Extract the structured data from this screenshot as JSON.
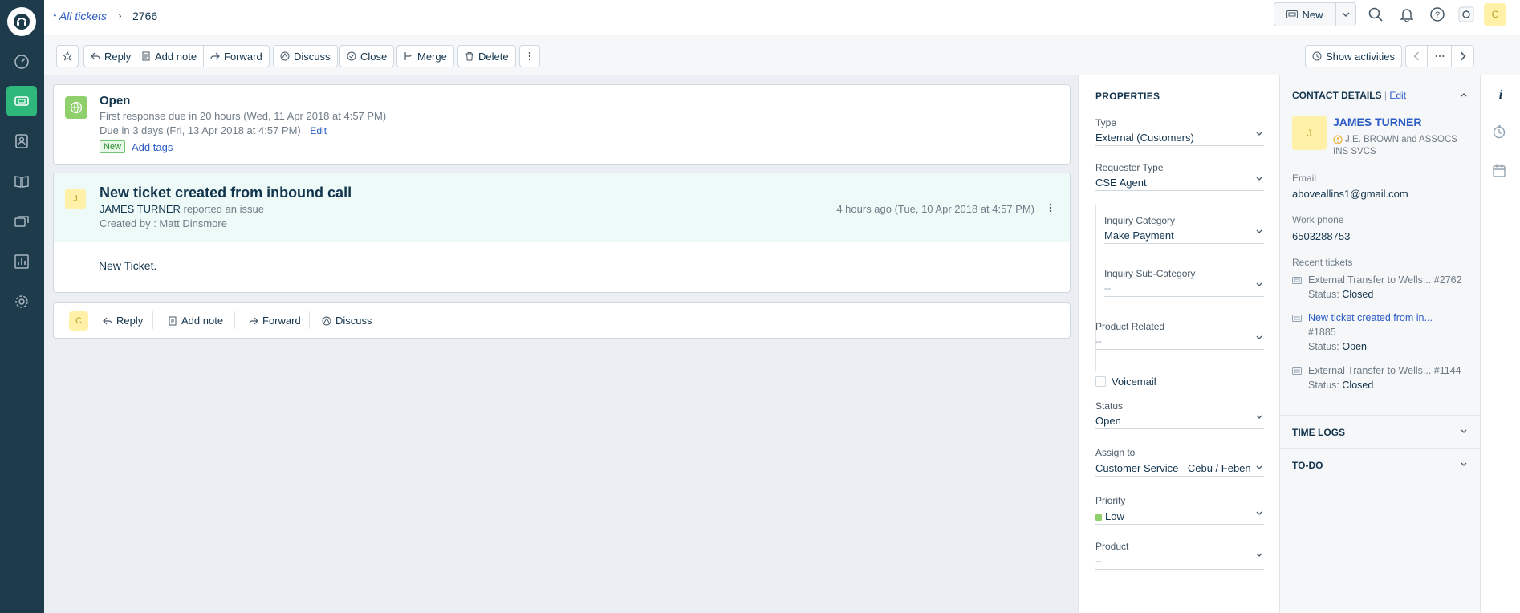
{
  "topbar": {
    "breadcrumb_link": "* All tickets",
    "ticket_id": "2766",
    "new_button": "New",
    "avatar_initial": "C"
  },
  "toolbar": {
    "reply": "Reply",
    "add_note": "Add note",
    "forward": "Forward",
    "discuss": "Discuss",
    "close": "Close",
    "merge": "Merge",
    "delete": "Delete",
    "show_activities": "Show activities"
  },
  "ticket_status": {
    "status": "Open",
    "first_response": "First response due in 20 hours (Wed, 11 Apr 2018 at 4:57 PM)",
    "due": "Due in 3 days (Fri, 13 Apr 2018 at 4:57 PM)",
    "edit": "Edit",
    "badge": "New",
    "add_tags": "Add tags"
  },
  "conversation": {
    "avatar_initial": "J",
    "title": "New ticket created from inbound call",
    "requester": "JAMES TURNER",
    "action": "reported an issue",
    "created_by": "Created by : Matt Dinsmore",
    "time": "4 hours ago (Tue, 10 Apr 2018 at 4:57 PM)",
    "body": "New Ticket."
  },
  "reply_bar": {
    "avatar_initial": "C",
    "reply": "Reply",
    "add_note": "Add note",
    "forward": "Forward",
    "discuss": "Discuss"
  },
  "properties": {
    "heading": "PROPERTIES",
    "type_label": "Type",
    "type_value": "External (Customers)",
    "requester_type_label": "Requester Type",
    "requester_type_value": "CSE Agent",
    "inquiry_category_label": "Inquiry Category",
    "inquiry_category_value": "Make Payment",
    "inquiry_sub_label": "Inquiry Sub-Category",
    "inquiry_sub_value": "--",
    "product_related_label": "Product Related",
    "product_related_value": "--",
    "voicemail_label": "Voicemail",
    "status_label": "Status",
    "status_value": "Open",
    "assign_label": "Assign to",
    "assign_value": "Customer Service - Cebu / Feben",
    "priority_label": "Priority",
    "priority_value": "Low",
    "product_label": "Product",
    "product_value": "--"
  },
  "contact": {
    "heading": "CONTACT DETAILS",
    "edit": "Edit",
    "avatar_initial": "J",
    "name": "JAMES TURNER",
    "company": "J.E. BROWN and ASSOCS INS SVCS",
    "email_label": "Email",
    "email_value": "aboveallins1@gmail.com",
    "phone_label": "Work phone",
    "phone_value": "6503288753",
    "recent_label": "Recent tickets",
    "recent": [
      {
        "title": "External Transfer to Wells...",
        "id": "#2762",
        "status_label": "Status:",
        "status": "Closed"
      },
      {
        "title": "New ticket created from in...",
        "id": "#1885",
        "status_label": "Status:",
        "status": "Open"
      },
      {
        "title": "External Transfer to Wells...",
        "id": "#1144",
        "status_label": "Status:",
        "status": "Closed"
      }
    ],
    "time_logs": "TIME LOGS",
    "todo": "TO-DO"
  },
  "colors": {
    "sidebar": "#1d3b4b",
    "accent_green": "#2fb87c",
    "link_blue": "#2c5cc5"
  }
}
